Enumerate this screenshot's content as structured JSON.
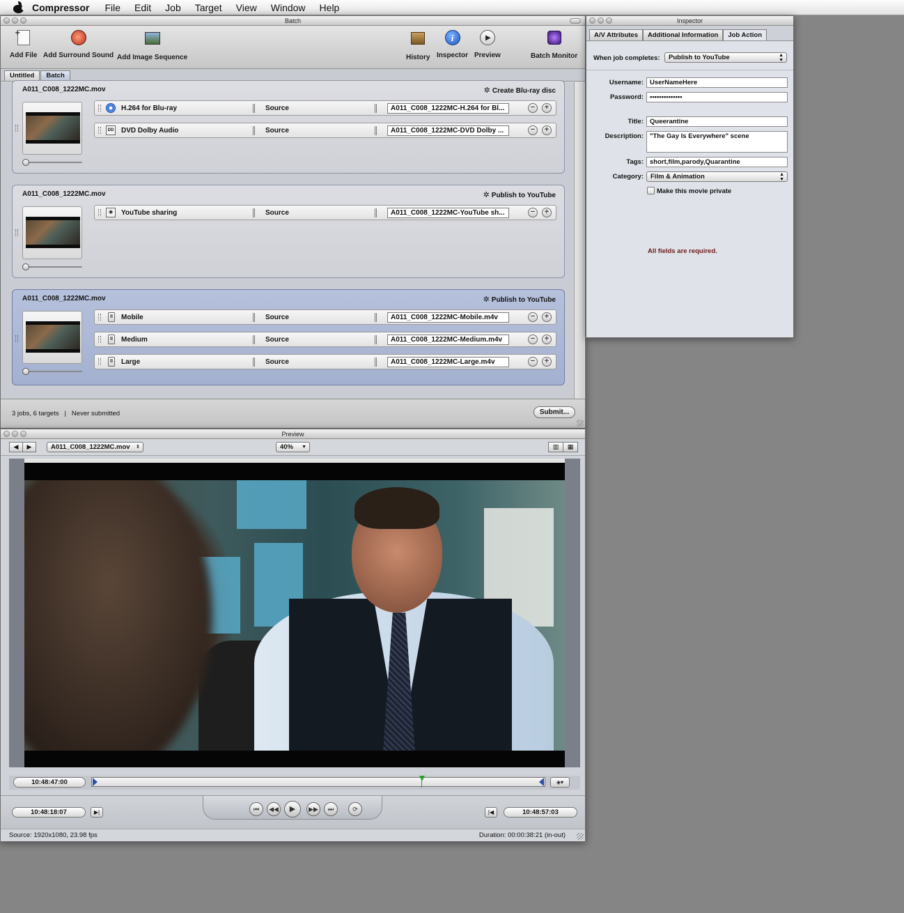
{
  "menubar": {
    "app_name": "Compressor",
    "items": [
      "File",
      "Edit",
      "Job",
      "Target",
      "View",
      "Window",
      "Help"
    ]
  },
  "batch_window": {
    "title": "Batch",
    "toolbar": {
      "add_file": "Add File",
      "add_surround": "Add Surround Sound",
      "add_image_seq": "Add Image Sequence",
      "history": "History",
      "inspector": "Inspector",
      "preview": "Preview",
      "batch_monitor": "Batch Monitor"
    },
    "tabs": [
      "Untitled",
      "Batch"
    ],
    "jobs": [
      {
        "name": "A011_C008_1222MC.mov",
        "action": "Create Blu-ray disc",
        "targets": [
          {
            "name": "H.264 for Blu-ray",
            "source": "Source",
            "output": "A011_C008_1222MC-H.264 for Bl...",
            "icon": "bluray-disc-icon"
          },
          {
            "name": "DVD Dolby Audio",
            "source": "Source",
            "output": "A011_C008_1222MC-DVD Dolby ...",
            "icon": "dolby-audio-icon"
          }
        ]
      },
      {
        "name": "A011_C008_1222MC.mov",
        "action": "Publish to YouTube",
        "targets": [
          {
            "name": "YouTube sharing",
            "source": "Source",
            "output": "A011_C008_1222MC-YouTube sh...",
            "icon": "youtube-sharing-icon"
          }
        ]
      },
      {
        "name": "A011_C008_1222MC.mov",
        "action": "Publish to YouTube",
        "targets": [
          {
            "name": "Mobile",
            "source": "Source",
            "output": "A011_C008_1222MC-Mobile.m4v",
            "icon": "device-icon"
          },
          {
            "name": "Medium",
            "source": "Source",
            "output": "A011_C008_1222MC-Medium.m4v",
            "icon": "device-icon"
          },
          {
            "name": "Large",
            "source": "Source",
            "output": "A011_C008_1222MC-Large.m4v",
            "icon": "device-icon"
          }
        ]
      }
    ],
    "status": {
      "summary": "3 jobs, 6 targets",
      "separator": "|",
      "state": "Never submitted",
      "submit": "Submit..."
    }
  },
  "inspector": {
    "title": "Inspector",
    "tabs": [
      "A/V Attributes",
      "Additional Information",
      "Job Action"
    ],
    "when_label": "When job completes:",
    "when_value": "Publish to YouTube",
    "username_label": "Username:",
    "username_value": "UserNameHere",
    "password_label": "Password:",
    "password_value": "••••••••••••••",
    "title_label": "Title:",
    "title_value": "Queerantine",
    "description_label": "Description:",
    "description_value": "\"The Gay Is Everywhere\" scene",
    "tags_label": "Tags:",
    "tags_value": "short,film,parody,Quarantine",
    "category_label": "Category:",
    "category_value": "Film & Animation",
    "private_label": "Make this movie private",
    "required_msg": "All fields are required."
  },
  "preview": {
    "title": "Preview",
    "source_select": "A011_C008_1222MC.mov",
    "zoom": "40%",
    "playhead_tc": "10:48:47:00",
    "in_tc": "10:48:18:07",
    "out_tc": "10:48:57:03",
    "source_info": "Source: 1920x1080, 23.98 fps",
    "duration": "Duration: 00:00:38:21 (in-out)"
  }
}
